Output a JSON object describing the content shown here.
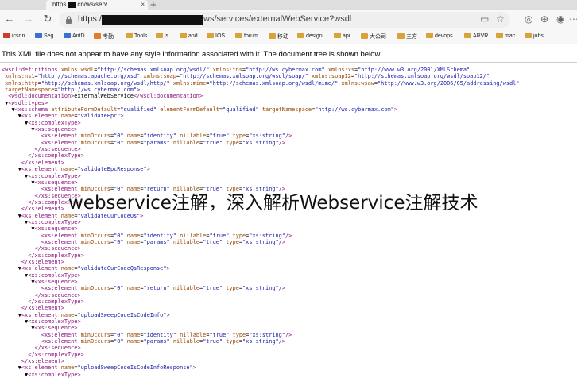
{
  "tab": {
    "title_prefix": "https",
    "title_suffix": "cn/ws/serv",
    "close": "×",
    "new_tab": "+"
  },
  "toolbar": {
    "back": "←",
    "forward": "→",
    "reload": "↻",
    "url_prefix": "https://",
    "url_rest": "ws/services/externalWebService?wsdl",
    "icons": [
      "reader-icon",
      "favorite-icon",
      "collections-icon",
      "extensions-icon",
      "profile-icon",
      "menu-icon"
    ]
  },
  "bookmarks": [
    {
      "label": "icsdn",
      "icon": "red"
    },
    {
      "label": "Seg",
      "icon": "blue"
    },
    {
      "label": "AntD",
      "icon": "blue"
    },
    {
      "label": "考勤",
      "icon": "orange"
    },
    {
      "label": "Tools",
      "icon": "folder"
    },
    {
      "label": "js",
      "icon": "folder"
    },
    {
      "label": "and",
      "icon": "folder"
    },
    {
      "label": "IOS",
      "icon": "folder"
    },
    {
      "label": "forum",
      "icon": "folder"
    },
    {
      "label": "移动",
      "icon": "folder"
    },
    {
      "label": "design",
      "icon": "folder"
    },
    {
      "label": "api",
      "icon": "folder"
    },
    {
      "label": "大公司",
      "icon": "folder"
    },
    {
      "label": "三方",
      "icon": "folder"
    },
    {
      "label": "devops",
      "icon": "folder"
    },
    {
      "label": "ARVR",
      "icon": "folder"
    },
    {
      "label": "mac",
      "icon": "folder"
    },
    {
      "label": "jobs",
      "icon": "folder"
    }
  ],
  "notice": "This XML file does not appear to have any style information associated with it. The document tree is shown below.",
  "xml_lines": [
    "<wsdl:definitions xmlns:wsdl=\"http://schemas.xmlsoap.org/wsdl/\" xmlns:tns=\"http://ws.cybermax.com\" xmlns:xs=\"http://www.w3.org/2001/XMLSchema\"",
    " xmlns:ns1=\"http://schemas.apache.org/xsd\" xmlns:soap=\"http://schemas.xmlsoap.org/wsdl/soap/\" xmlns:soap12=\"http://schemas.xmlsoap.org/wsdl/soap12/\"",
    " xmlns:http=\"http://schemas.xmlsoap.org/wsdl/http/\" xmlns:mime=\"http://schemas.xmlsoap.org/wsdl/mime/\" xmlns:wsaw=\"http://www.w3.org/2006/05/addressing/wsdl\"",
    " targetNamespace=\"http://ws.cybermax.com\">",
    "  <wsdl:documentation>externalWebService</wsdl:documentation>",
    " ▼<wsdl:types>",
    "   ▼<xs:schema attributeFormDefault=\"qualified\" elementFormDefault=\"qualified\" targetNamespace=\"http://ws.cybermax.com\">",
    "     ▼<xs:element name=\"validateEpc\">",
    "       ▼<xs:complexType>",
    "         ▼<xs:sequence>",
    "            <xs:element minOccurs=\"0\" name=\"identity\" nillable=\"true\" type=\"xs:string\"/>",
    "            <xs:element minOccurs=\"0\" name=\"params\" nillable=\"true\" type=\"xs:string\"/>",
    "          </xs:sequence>",
    "        </xs:complexType>",
    "      </xs:element>",
    "     ▼<xs:element name=\"validateEpcResponse\">",
    "       ▼<xs:complexType>",
    "         ▼<xs:sequence>",
    "            <xs:element minOccurs=\"0\" name=\"return\" nillable=\"true\" type=\"xs:string\"/>",
    "          </xs:sequence>",
    "        </xs:complexType>",
    "      </xs:element>",
    "     ▼<xs:element name=\"validateCurCodeQs\">",
    "       ▼<xs:complexType>",
    "         ▼<xs:sequence>",
    "            <xs:element minOccurs=\"0\" name=\"identity\" nillable=\"true\" type=\"xs:string\"/>",
    "            <xs:element minOccurs=\"0\" name=\"params\" nillable=\"true\" type=\"xs:string\"/>",
    "          </xs:sequence>",
    "        </xs:complexType>",
    "      </xs:element>",
    "     ▼<xs:element name=\"validateCurCodeQsResponse\">",
    "       ▼<xs:complexType>",
    "         ▼<xs:sequence>",
    "            <xs:element minOccurs=\"0\" name=\"return\" nillable=\"true\" type=\"xs:string\"/>",
    "          </xs:sequence>",
    "        </xs:complexType>",
    "      </xs:element>",
    "     ▼<xs:element name=\"uploadSweepCodeIsCodeInfo\">",
    "       ▼<xs:complexType>",
    "         ▼<xs:sequence>",
    "            <xs:element minOccurs=\"0\" name=\"identity\" nillable=\"true\" type=\"xs:string\"/>",
    "            <xs:element minOccurs=\"0\" name=\"params\" nillable=\"true\" type=\"xs:string\"/>",
    "          </xs:sequence>",
    "        </xs:complexType>",
    "      </xs:element>",
    "     ▼<xs:element name=\"uploadSweepCodeIsCodeInfoResponse\">",
    "       ▼<xs:complexType>"
  ],
  "overlay_caption": "webservice注解，深入解析Webservice注解技术"
}
